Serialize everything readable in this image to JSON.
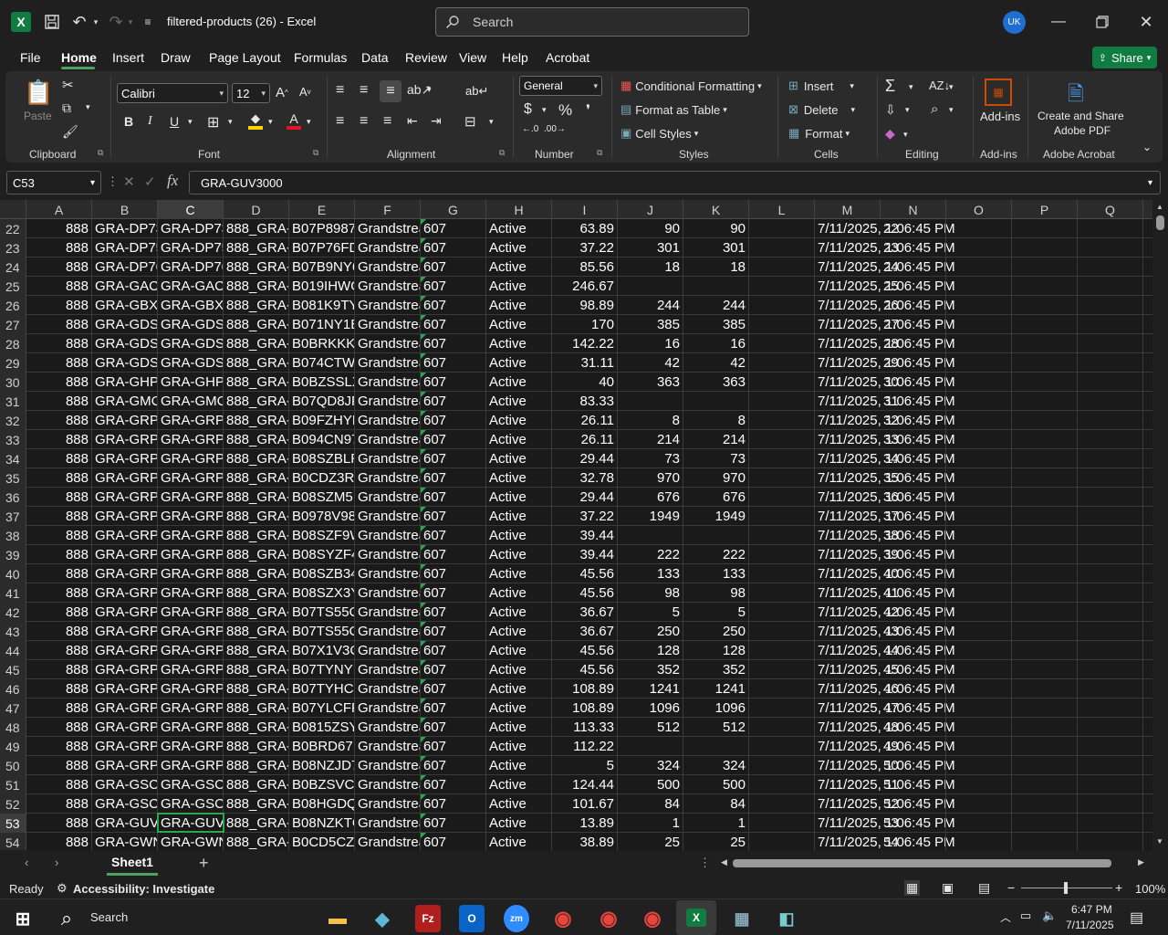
{
  "window": {
    "title": "filtered-products (26)  -  Excel",
    "search_placeholder": "Search",
    "user_initials": "UK"
  },
  "menu": {
    "items": [
      "File",
      "Home",
      "Insert",
      "Draw",
      "Page Layout",
      "Formulas",
      "Data",
      "Review",
      "View",
      "Help",
      "Acrobat"
    ],
    "share_label": "Share"
  },
  "ribbon": {
    "groups": [
      "Clipboard",
      "Font",
      "Alignment",
      "Number",
      "Styles",
      "Cells",
      "Editing",
      "Add-ins",
      "Adobe Acrobat"
    ],
    "paste_label": "Paste",
    "font_name": "Calibri",
    "font_size": "12",
    "number_format": "General",
    "conditional_formatting": "Conditional Formatting",
    "format_as_table": "Format as Table",
    "cell_styles": "Cell Styles",
    "insert": "Insert",
    "delete": "Delete",
    "format": "Format",
    "add_ins": "Add-ins",
    "create_share_1": "Create and Share",
    "create_share_2": "Adobe PDF"
  },
  "formula_bar": {
    "name_box": "C53",
    "content": "GRA-GUV3000"
  },
  "columns": [
    "A",
    "B",
    "C",
    "D",
    "E",
    "F",
    "G",
    "H",
    "I",
    "J",
    "K",
    "L",
    "M",
    "N",
    "O",
    "P",
    "Q"
  ],
  "selected_column": "C",
  "selected_row": "53",
  "rows": [
    {
      "n": "22",
      "a": "888",
      "b": "GRA-DP73(",
      "c": "GRA-DP73(",
      "d": "888_GRA-I",
      "e": "B07P8987E",
      "f": "Grandstrea",
      "g": "607",
      "h": "Active",
      "i": "63.89",
      "j": "90",
      "k": "90",
      "m": "7/11/2025, 1:06:45 PM"
    },
    {
      "n": "23",
      "a": "888",
      "b": "GRA-DP75:",
      "c": "GRA-DP75:",
      "d": "888_GRA-I",
      "e": "B07P76FD(",
      "f": "Grandstrea",
      "g": "607",
      "h": "Active",
      "i": "37.22",
      "j": "301",
      "k": "301",
      "m": "7/11/2025, 1:06:45 PM"
    },
    {
      "n": "24",
      "a": "888",
      "b": "GRA-DP76(",
      "c": "GRA-DP76(",
      "d": "888_GRA-I",
      "e": "B07B9NY6",
      "f": "Grandstrea",
      "g": "607",
      "h": "Active",
      "i": "85.56",
      "j": "18",
      "k": "18",
      "m": "7/11/2025, 1:06:45 PM"
    },
    {
      "n": "25",
      "a": "888",
      "b": "GRA-GAC2",
      "c": "GRA-GAC2",
      "d": "888_GRA-(",
      "e": "B019IHWG",
      "f": "Grandstrea",
      "g": "607",
      "h": "Active",
      "i": "246.67",
      "j": "",
      "k": "",
      "m": "7/11/2025, 1:06:45 PM"
    },
    {
      "n": "26",
      "a": "888",
      "b": "GRA-GBX2",
      "c": "GRA-GBX2",
      "d": "888_GRA-(",
      "e": "B081K9TY\\",
      "f": "Grandstrea",
      "g": "607",
      "h": "Active",
      "i": "98.89",
      "j": "244",
      "k": "244",
      "m": "7/11/2025, 1:06:45 PM"
    },
    {
      "n": "27",
      "a": "888",
      "b": "GRA-GDS3",
      "c": "GRA-GDS3",
      "d": "888_GRA-(",
      "e": "B071NY1B",
      "f": "Grandstrea",
      "g": "607",
      "h": "Active",
      "i": "170",
      "j": "385",
      "k": "385",
      "m": "7/11/2025, 1:06:45 PM"
    },
    {
      "n": "28",
      "a": "888",
      "b": "GRA-GDS3",
      "c": "GRA-GDS3",
      "d": "888_GRA-(",
      "e": "B0BRKKK7",
      "f": "Grandstrea",
      "g": "607",
      "h": "Active",
      "i": "142.22",
      "j": "16",
      "k": "16",
      "m": "7/11/2025, 1:06:45 PM"
    },
    {
      "n": "29",
      "a": "888",
      "b": "GRA-GDS3",
      "c": "GRA-GDS3",
      "d": "888_GRA-(",
      "e": "B074CTWT",
      "f": "Grandstrea",
      "g": "607",
      "h": "Active",
      "i": "31.11",
      "j": "42",
      "k": "42",
      "m": "7/11/2025, 1:06:45 PM"
    },
    {
      "n": "30",
      "a": "888",
      "b": "GRA-GHP6",
      "c": "GRA-GHP6",
      "d": "888_GRA-(",
      "e": "B0BZSSLX6",
      "f": "Grandstrea",
      "g": "607",
      "h": "Active",
      "i": "40",
      "j": "363",
      "k": "363",
      "m": "7/11/2025, 1:06:45 PM"
    },
    {
      "n": "31",
      "a": "888",
      "b": "GRA-GMC(",
      "c": "GRA-GMC(",
      "d": "888_GRA-(",
      "e": "B07QD8JF.",
      "f": "Grandstrea",
      "g": "607",
      "h": "Active",
      "i": "83.33",
      "j": "",
      "k": "",
      "m": "7/11/2025, 1:06:45 PM"
    },
    {
      "n": "32",
      "a": "888",
      "b": "GRA-GRP2",
      "c": "GRA-GRP2",
      "d": "888_GRA-(",
      "e": "B09FZHYR",
      "f": "Grandstrea",
      "g": "607",
      "h": "Active",
      "i": "26.11",
      "j": "8",
      "k": "8",
      "m": "7/11/2025, 1:06:45 PM"
    },
    {
      "n": "33",
      "a": "888",
      "b": "GRA-GRP2",
      "c": "GRA-GRP2",
      "d": "888_GRA-(",
      "e": "B094CN97",
      "f": "Grandstrea",
      "g": "607",
      "h": "Active",
      "i": "26.11",
      "j": "214",
      "k": "214",
      "m": "7/11/2025, 1:06:45 PM"
    },
    {
      "n": "34",
      "a": "888",
      "b": "GRA-GRP2",
      "c": "GRA-GRP2",
      "d": "888_GRA-(",
      "e": "B08SZBLR(",
      "f": "Grandstrea",
      "g": "607",
      "h": "Active",
      "i": "29.44",
      "j": "73",
      "k": "73",
      "m": "7/11/2025, 1:06:45 PM"
    },
    {
      "n": "35",
      "a": "888",
      "b": "GRA-GRP2",
      "c": "GRA-GRP2",
      "d": "888_GRA-(",
      "e": "B0CDZ3R4",
      "f": "Grandstrea",
      "g": "607",
      "h": "Active",
      "i": "32.78",
      "j": "970",
      "k": "970",
      "m": "7/11/2025, 1:06:45 PM"
    },
    {
      "n": "36",
      "a": "888",
      "b": "GRA-GRP2",
      "c": "GRA-GRP2",
      "d": "888_GRA-(",
      "e": "B08SZM5K",
      "f": "Grandstrea",
      "g": "607",
      "h": "Active",
      "i": "29.44",
      "j": "676",
      "k": "676",
      "m": "7/11/2025, 1:06:45 PM"
    },
    {
      "n": "37",
      "a": "888",
      "b": "GRA-GRP2",
      "c": "GRA-GRP2",
      "d": "888_GRA-(",
      "e": "B0978V98(",
      "f": "Grandstrea",
      "g": "607",
      "h": "Active",
      "i": "37.22",
      "j": "1949",
      "k": "1949",
      "m": "7/11/2025, 1:06:45 PM"
    },
    {
      "n": "38",
      "a": "888",
      "b": "GRA-GRP2",
      "c": "GRA-GRP2",
      "d": "888_GRA-(",
      "e": "B08SZF9W",
      "f": "Grandstrea",
      "g": "607",
      "h": "Active",
      "i": "39.44",
      "j": "",
      "k": "",
      "m": "7/11/2025, 1:06:45 PM"
    },
    {
      "n": "39",
      "a": "888",
      "b": "GRA-GRP2",
      "c": "GRA-GRP2",
      "d": "888_GRA-(",
      "e": "B08SYZF4V",
      "f": "Grandstrea",
      "g": "607",
      "h": "Active",
      "i": "39.44",
      "j": "222",
      "k": "222",
      "m": "7/11/2025, 1:06:45 PM"
    },
    {
      "n": "40",
      "a": "888",
      "b": "GRA-GRP2",
      "c": "GRA-GRP2",
      "d": "888_GRA-(",
      "e": "B08SZB347",
      "f": "Grandstrea",
      "g": "607",
      "h": "Active",
      "i": "45.56",
      "j": "133",
      "k": "133",
      "m": "7/11/2025, 1:06:45 PM"
    },
    {
      "n": "41",
      "a": "888",
      "b": "GRA-GRP2",
      "c": "GRA-GRP2",
      "d": "888_GRA-(",
      "e": "B08SZX3YS",
      "f": "Grandstrea",
      "g": "607",
      "h": "Active",
      "i": "45.56",
      "j": "98",
      "k": "98",
      "m": "7/11/2025, 1:06:45 PM"
    },
    {
      "n": "42",
      "a": "888",
      "b": "GRA-GRP2",
      "c": "GRA-GRP2",
      "d": "888_GRA-(",
      "e": "B07TS55CS",
      "f": "Grandstrea",
      "g": "607",
      "h": "Active",
      "i": "36.67",
      "j": "5",
      "k": "5",
      "m": "7/11/2025, 1:06:45 PM"
    },
    {
      "n": "43",
      "a": "888",
      "b": "GRA-GRP2",
      "c": "GRA-GRP2",
      "d": "888_GRA-(",
      "e": "B07TS55CS",
      "f": "Grandstrea",
      "g": "607",
      "h": "Active",
      "i": "36.67",
      "j": "250",
      "k": "250",
      "m": "7/11/2025, 1:06:45 PM"
    },
    {
      "n": "44",
      "a": "888",
      "b": "GRA-GRP2",
      "c": "GRA-GRP2",
      "d": "888_GRA-(",
      "e": "B07X1V3C(",
      "f": "Grandstrea",
      "g": "607",
      "h": "Active",
      "i": "45.56",
      "j": "128",
      "k": "128",
      "m": "7/11/2025, 1:06:45 PM"
    },
    {
      "n": "45",
      "a": "888",
      "b": "GRA-GRP2",
      "c": "GRA-GRP2",
      "d": "888_GRA-(",
      "e": "B07TYNYF:",
      "f": "Grandstrea",
      "g": "607",
      "h": "Active",
      "i": "45.56",
      "j": "352",
      "k": "352",
      "m": "7/11/2025, 1:06:45 PM"
    },
    {
      "n": "46",
      "a": "888",
      "b": "GRA-GRP2",
      "c": "GRA-GRP2",
      "d": "888_GRA-(",
      "e": "B07TYHC4",
      "f": "Grandstrea",
      "g": "607",
      "h": "Active",
      "i": "108.89",
      "j": "1241",
      "k": "1241",
      "m": "7/11/2025, 1:06:45 PM"
    },
    {
      "n": "47",
      "a": "888",
      "b": "GRA-GRP2",
      "c": "GRA-GRP2",
      "d": "888_GRA-(",
      "e": "B07YLCFPF",
      "f": "Grandstrea",
      "g": "607",
      "h": "Active",
      "i": "108.89",
      "j": "1096",
      "k": "1096",
      "m": "7/11/2025, 1:06:45 PM"
    },
    {
      "n": "48",
      "a": "888",
      "b": "GRA-GRP2",
      "c": "GRA-GRP2",
      "d": "888_GRA-(",
      "e": "B0815ZSY\\",
      "f": "Grandstrea",
      "g": "607",
      "h": "Active",
      "i": "113.33",
      "j": "512",
      "k": "512",
      "m": "7/11/2025, 1:06:45 PM"
    },
    {
      "n": "49",
      "a": "888",
      "b": "GRA-GRP2",
      "c": "GRA-GRP2",
      "d": "888_GRA-(",
      "e": "B0BRD67N",
      "f": "Grandstrea",
      "g": "607",
      "h": "Active",
      "i": "112.22",
      "j": "",
      "k": "",
      "m": "7/11/2025, 1:06:45 PM"
    },
    {
      "n": "50",
      "a": "888",
      "b": "GRA-GRP-\\",
      "c": "GRA-GRP-\\",
      "d": "888_GRA-(",
      "e": "B08NZJD7:",
      "f": "Grandstrea",
      "g": "607",
      "h": "Active",
      "i": "5",
      "j": "324",
      "k": "324",
      "m": "7/11/2025, 1:06:45 PM"
    },
    {
      "n": "51",
      "a": "888",
      "b": "GRA-GSC3:",
      "c": "GRA-GSC3:",
      "d": "888_GRA-(",
      "e": "B0BZSVCR",
      "f": "Grandstrea",
      "g": "607",
      "h": "Active",
      "i": "124.44",
      "j": "500",
      "k": "500",
      "m": "7/11/2025, 1:06:45 PM"
    },
    {
      "n": "52",
      "a": "888",
      "b": "GRA-GSC3:",
      "c": "GRA-GSC3:",
      "d": "888_GRA-(",
      "e": "B08HGDQ(",
      "f": "Grandstrea",
      "g": "607",
      "h": "Active",
      "i": "101.67",
      "j": "84",
      "k": "84",
      "m": "7/11/2025, 1:06:45 PM"
    },
    {
      "n": "53",
      "a": "888",
      "b": "GRA-GUV3",
      "c": "GRA-GUV3",
      "d": "888_GRA-(",
      "e": "B08NZKTG",
      "f": "Grandstrea",
      "g": "607",
      "h": "Active",
      "i": "13.89",
      "j": "1",
      "k": "1",
      "m": "7/11/2025, 1:06:45 PM"
    },
    {
      "n": "54",
      "a": "888",
      "b": "GRA-GWN",
      "c": "GRA-GWN",
      "d": "888_GRA-(",
      "e": "B0CD5CZZ",
      "f": "Grandstrea",
      "g": "607",
      "h": "Active",
      "i": "38.89",
      "j": "25",
      "k": "25",
      "m": "7/11/2025, 1:06:45 PM"
    }
  ],
  "sheet_tab": "Sheet1",
  "status": {
    "ready": "Ready",
    "accessibility": "Accessibility: Investigate",
    "zoom": "100%"
  },
  "taskbar": {
    "search_label": "Search",
    "time": "6:47 PM",
    "date": "7/11/2025"
  },
  "colors": {
    "excel_green": "#107c41",
    "accent_green": "#2ea44f",
    "ribbon_bg": "#2b2b2b"
  }
}
